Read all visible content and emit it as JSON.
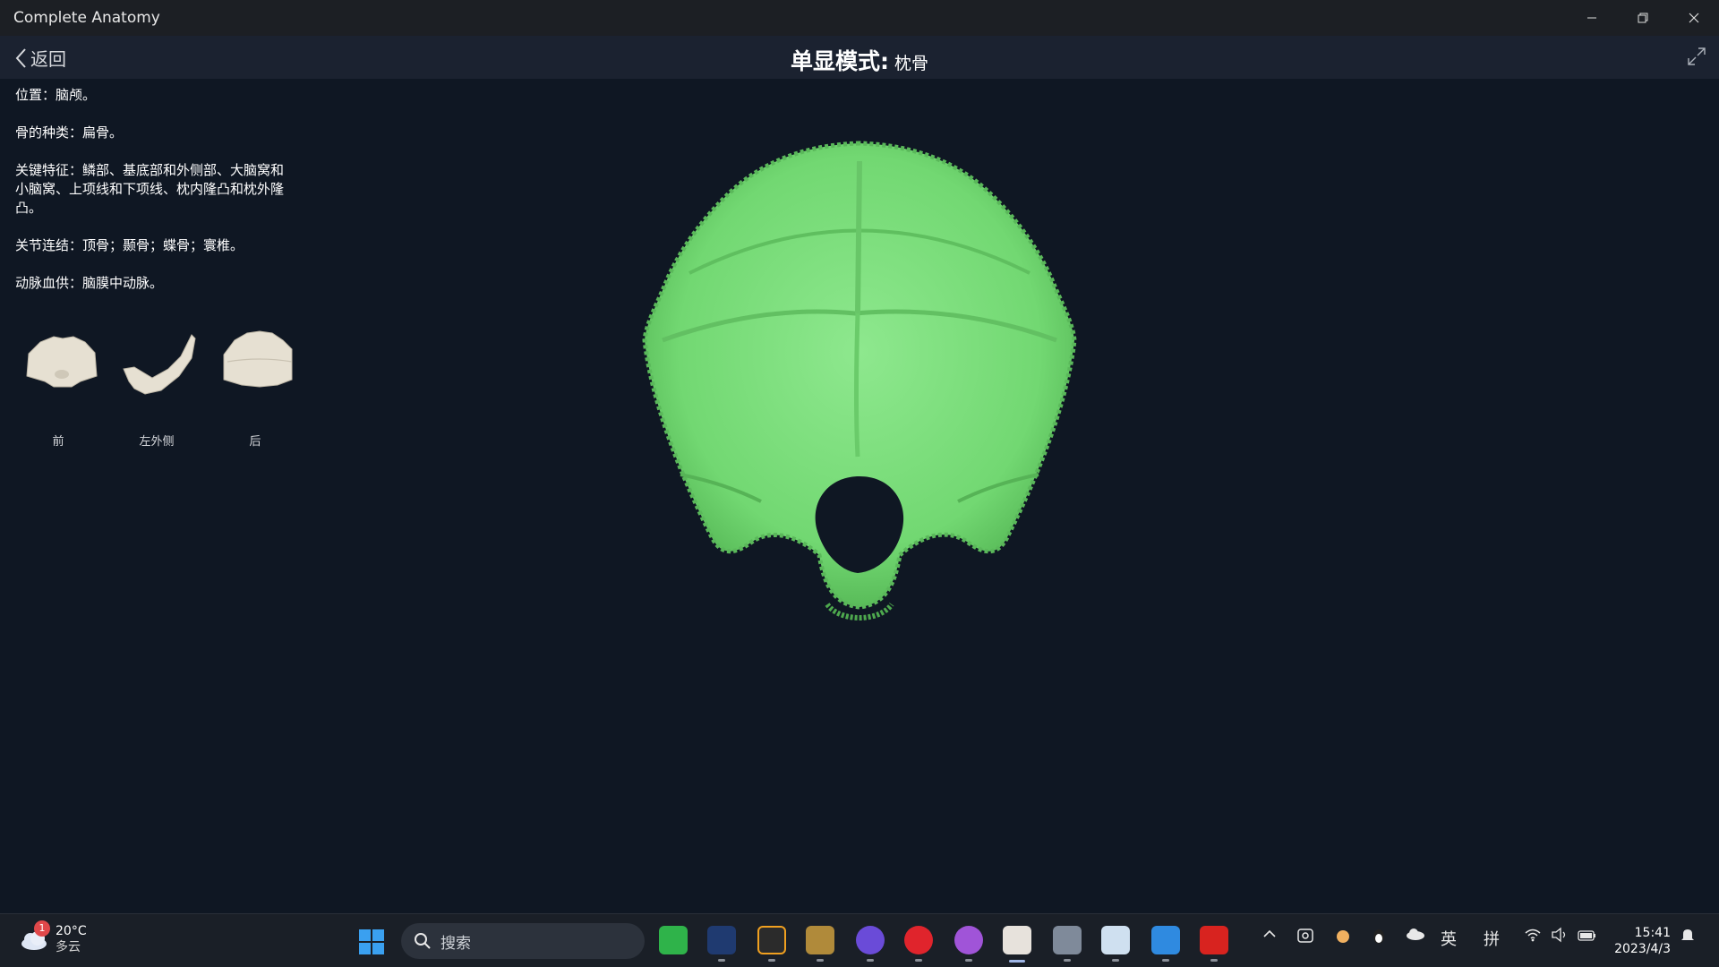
{
  "window": {
    "title": "Complete Anatomy"
  },
  "header": {
    "back_label": "返回",
    "mode_label": "单显模式:",
    "bone_name": "枕骨"
  },
  "info": {
    "location": "位置：脑颅。",
    "bone_type": "骨的种类：扁骨。",
    "features": "关键特征：鳞部、基底部和外侧部、大脑窝和小脑窝、上项线和下项线、枕内隆凸和枕外隆凸。",
    "articulations": "关节连结：顶骨；颞骨；蝶骨；寰椎。",
    "blood_supply": "动脉血供：脑膜中动脉。"
  },
  "views": [
    {
      "label": "前",
      "icon": "bone-front-thumbnail"
    },
    {
      "label": "左外侧",
      "icon": "bone-lateral-thumbnail"
    },
    {
      "label": "后",
      "icon": "bone-posterior-thumbnail"
    }
  ],
  "bone_color": "#7fe07f",
  "taskbar": {
    "weather": {
      "temp": "20°C",
      "condition": "多云",
      "badge": "1"
    },
    "search_placeholder": "搜索",
    "ime_lang": "英",
    "ime_mode": "拼",
    "time": "15:41",
    "date": "2023/4/3"
  }
}
